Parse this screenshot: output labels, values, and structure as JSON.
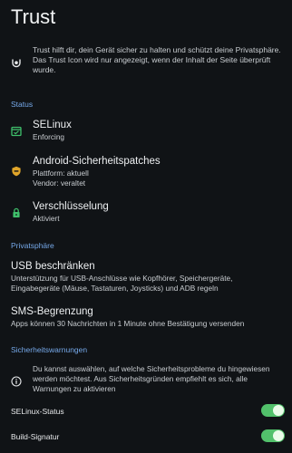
{
  "page": {
    "title": "Trust"
  },
  "intro": {
    "icon": "trust-logo-icon",
    "text": "Trust hilft dir, dein Gerät sicher zu halten und schützt deine Privatsphäre. Das Trust Icon wird nur angezeigt, wenn der Inhalt der Seite überprüft wurde."
  },
  "sections": {
    "status": "Status",
    "privacy": "Privatsphäre",
    "warnings": "Sicherheitswarnungen"
  },
  "status_items": {
    "selinux": {
      "title": "SELinux",
      "sub": "Enforcing",
      "icon": "selinux-icon"
    },
    "patches": {
      "title": "Android-Sicherheitspatches",
      "sub1": "Plattform: aktuell",
      "sub2": "Vendor: veraltet",
      "icon": "shield-icon"
    },
    "encryption": {
      "title": "Verschlüsselung",
      "sub": "Aktiviert",
      "icon": "lock-icon"
    }
  },
  "privacy_items": {
    "usb": {
      "title": "USB beschränken",
      "sub1": "Unterstützung für USB-Anschlüsse wie Kopfhörer, Speichergeräte,",
      "sub2": "Eingabegeräte (Mäuse, Tastaturen, Joysticks) und ADB regeln"
    },
    "sms": {
      "title": "SMS-Begrenzung",
      "sub": "Apps können 30 Nachrichten in 1 Minute ohne Bestätigung versenden"
    }
  },
  "warnings_info": {
    "icon": "info-icon",
    "text": "Du kannst auswählen, auf welche Sicherheitsprobleme du hingewiesen werden möchtest. Aus Sicherheitsgründen empfiehlt es sich, alle Warnungen zu aktivieren"
  },
  "toggles": [
    {
      "label": "SELinux-Status",
      "enabled": true
    },
    {
      "label": "Build-Signatur",
      "enabled": true
    }
  ],
  "colors": {
    "background": "#101316",
    "accent": "#76a9ea",
    "toggle_on": "#52c16b",
    "status_ok": "#3fbf6b",
    "status_warn": "#e0a52a"
  }
}
